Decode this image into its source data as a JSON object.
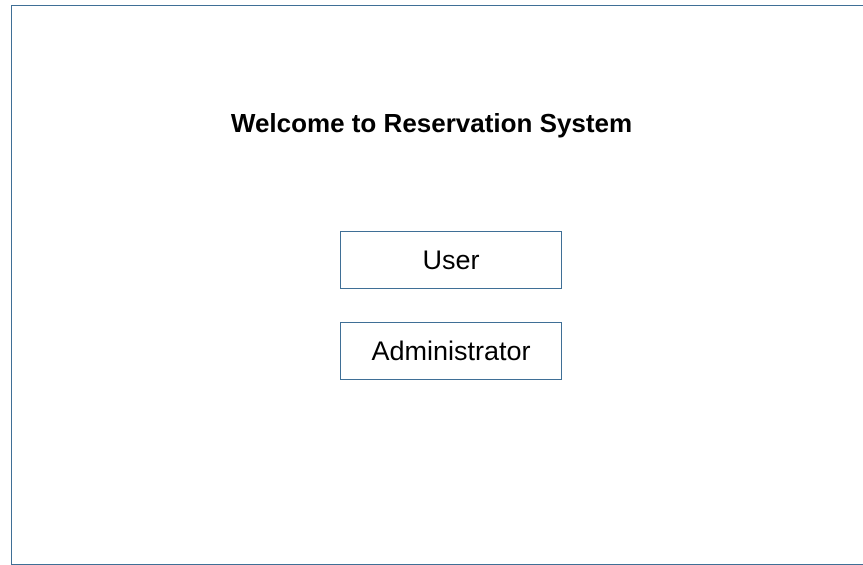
{
  "title": "Welcome to Reservation System",
  "buttons": {
    "user": "User",
    "administrator": "Administrator"
  },
  "colors": {
    "border": "#3f6f96",
    "background": "#ffffff",
    "text": "#000000"
  }
}
